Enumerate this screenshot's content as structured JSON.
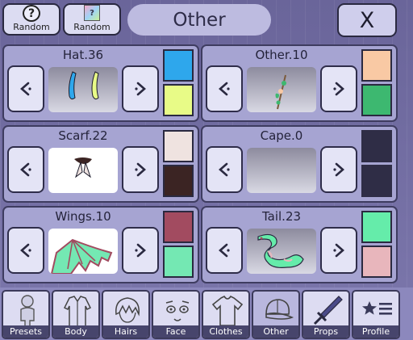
{
  "header": {
    "random_label_1": "Random",
    "random_label_2": "Random",
    "random_q_glyph": "?",
    "random_img_glyph": "?",
    "title": "Other",
    "close_label": "X"
  },
  "arrow_left_icon": "chevron-left-icon",
  "arrow_right_icon": "chevron-right-icon",
  "slots": [
    {
      "name": "Hat.36",
      "color_1": "#2ea7ec",
      "color_2": "#e8fb87"
    },
    {
      "name": "Other.10",
      "color_1": "#f9c9a4",
      "color_2": "#3db870"
    },
    {
      "name": "Scarf.22",
      "color_1": "#efe3e0",
      "color_2": "#3b2423"
    },
    {
      "name": "Cape.0",
      "color_1": "",
      "color_2": ""
    },
    {
      "name": "Wings.10",
      "color_1": "#a24b60",
      "color_2": "#74e8b3"
    },
    {
      "name": "Tail.23",
      "color_1": "#65ecaa",
      "color_2": "#e8b6bc"
    }
  ],
  "nav": {
    "tabs": [
      {
        "label": "Presets",
        "icon": "person-icon"
      },
      {
        "label": "Body",
        "icon": "jacket-icon"
      },
      {
        "label": "Hairs",
        "icon": "hair-icon"
      },
      {
        "label": "Face",
        "icon": "face-icon"
      },
      {
        "label": "Clothes",
        "icon": "shirt-icon"
      },
      {
        "label": "Other",
        "icon": "cap-icon",
        "active": true
      },
      {
        "label": "Props",
        "icon": "sword-icon"
      },
      {
        "label": "Profile",
        "icon": "star-list-icon"
      }
    ]
  }
}
